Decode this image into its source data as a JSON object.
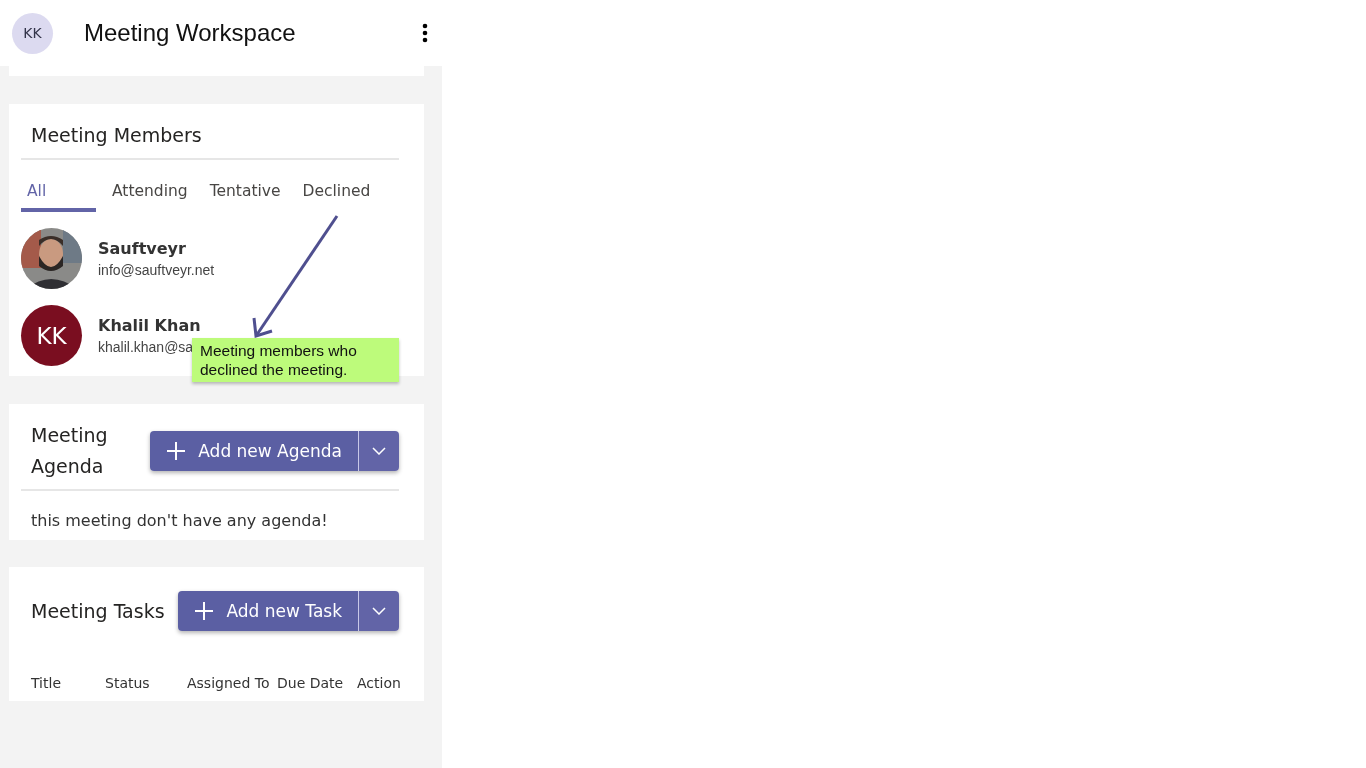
{
  "header": {
    "avatar": "KK",
    "title": "Meeting Workspace"
  },
  "members": {
    "title": "Meeting Members",
    "tabs": [
      {
        "label": "All",
        "selected": true
      },
      {
        "label": "Attending",
        "selected": false
      },
      {
        "label": "Tentative",
        "selected": false
      },
      {
        "label": "Declined",
        "selected": false
      }
    ],
    "people": [
      {
        "name": "Sauftveyr",
        "email": "info@sauftveyr.net"
      },
      {
        "kind": "initials",
        "initials": "KK",
        "color": "#7a0e20",
        "name": "Khalil Khan",
        "email": "khalil.khan@sa"
      }
    ],
    "callout": "Meeting members who declined the meeting."
  },
  "agenda": {
    "title": "Meeting Agenda",
    "button": "Add new Agenda",
    "empty": "this meeting don't have any agenda!"
  },
  "tasks": {
    "title": "Meeting Tasks",
    "button": "Add new Task",
    "columns": [
      "Title",
      "Status",
      "Assigned To",
      "Due Date",
      "Action"
    ]
  }
}
